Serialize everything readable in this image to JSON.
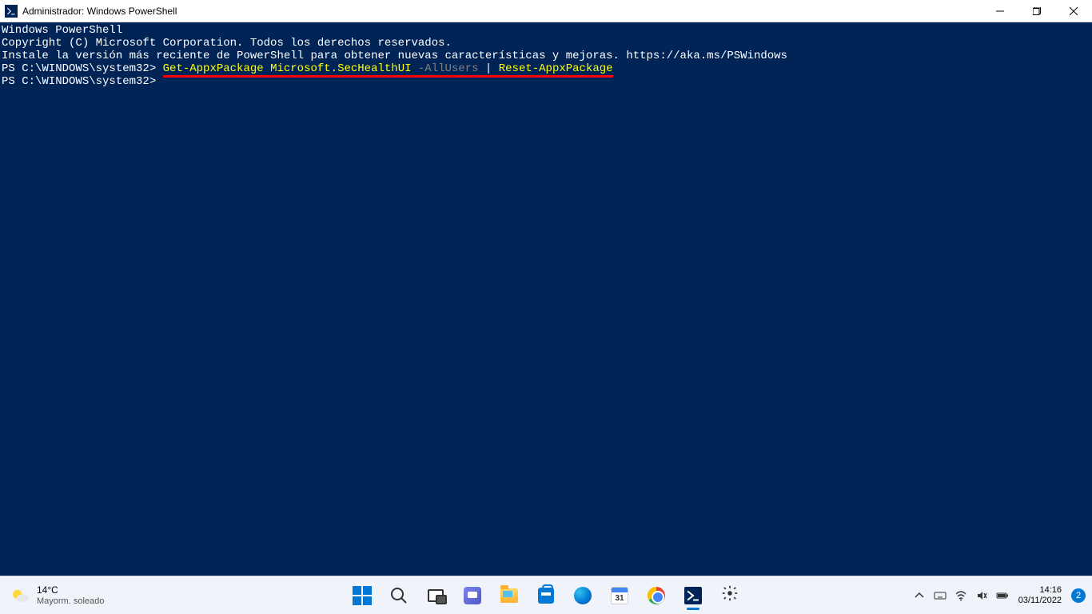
{
  "window": {
    "title": "Administrador: Windows PowerShell"
  },
  "console": {
    "line1": "Windows PowerShell",
    "line2": "Copyright (C) Microsoft Corporation. Todos los derechos reservados.",
    "line3": "",
    "line4": "Instale la versión más reciente de PowerShell para obtener nuevas características y mejoras. https://aka.ms/PSWindows",
    "line5": "",
    "prompt1": "PS C:\\WINDOWS\\system32> ",
    "cmd1_part1": "Get-AppxPackage Microsoft.SecHealthUI ",
    "cmd1_flag": "-AllUsers ",
    "cmd1_pipe": "| ",
    "cmd1_part2": "Reset-AppxPackage",
    "prompt2": "PS C:\\WINDOWS\\system32>"
  },
  "taskbar": {
    "weather": {
      "temp": "14°C",
      "condition": "Mayorm. soleado"
    },
    "calendar_day": "31",
    "clock": {
      "time": "14:16",
      "date": "03/11/2022"
    },
    "notif_count": "2"
  }
}
